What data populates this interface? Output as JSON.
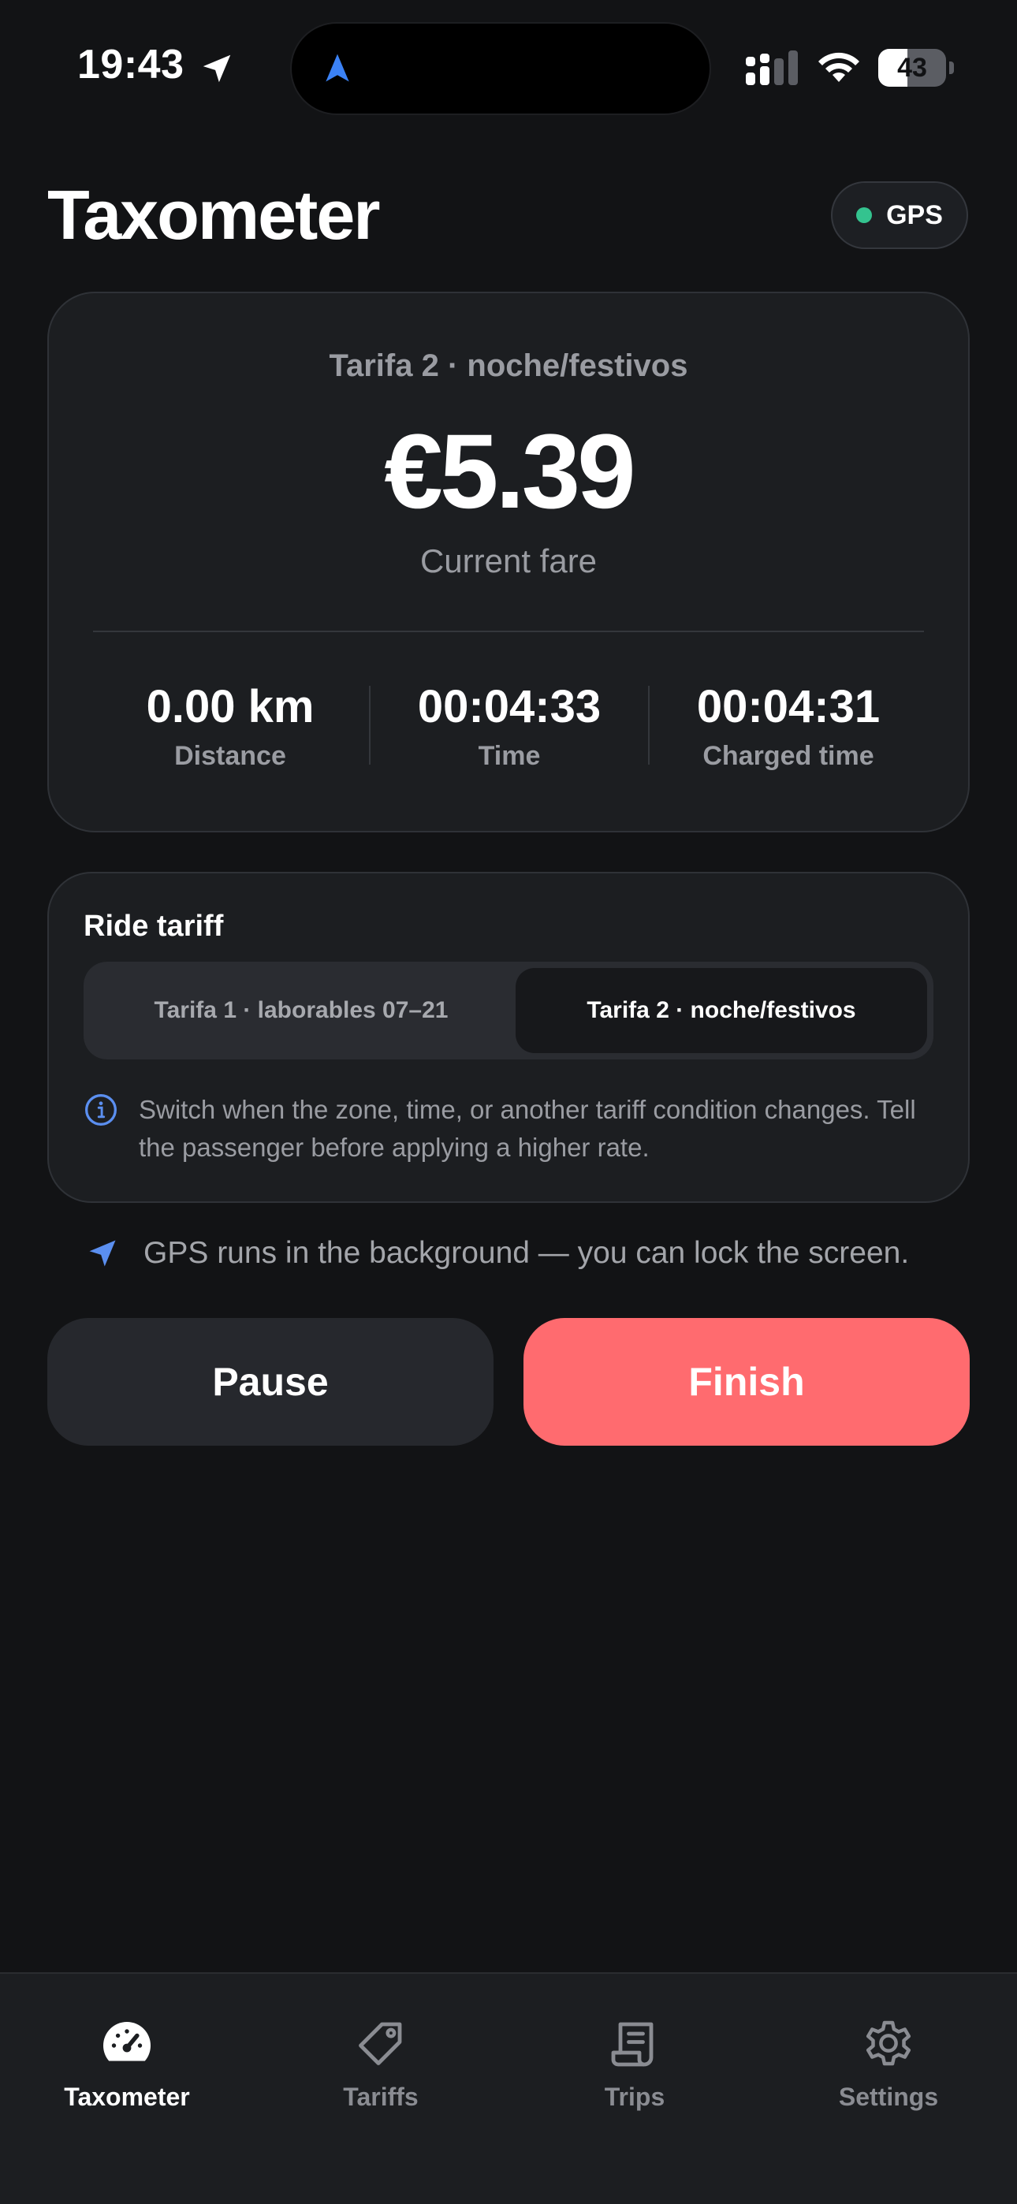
{
  "status_bar": {
    "time": "19:43",
    "battery": "43",
    "battery_level": 0.43
  },
  "header": {
    "title": "Taxometer",
    "gps_badge": "GPS"
  },
  "fare_card": {
    "tariff_label": "Tarifa 2 · noche/festivos",
    "amount": "€5.39",
    "caption": "Current fare",
    "stats": [
      {
        "value": "0.00 km",
        "label": "Distance"
      },
      {
        "value": "00:04:33",
        "label": "Time"
      },
      {
        "value": "00:04:31",
        "label": "Charged time"
      }
    ]
  },
  "tariff_card": {
    "heading": "Ride tariff",
    "options": [
      {
        "label": "Tarifa 1 · laborables 07–21",
        "selected": false
      },
      {
        "label": "Tarifa 2 · noche/festivos",
        "selected": true
      }
    ],
    "note": "Switch when the zone, time, or another tariff condition changes. Tell the passenger before applying a higher rate."
  },
  "gps_hint": "GPS runs in the background — you can lock the screen.",
  "actions": {
    "pause": "Pause",
    "finish": "Finish"
  },
  "tab_bar": {
    "items": [
      {
        "label": "Taxometer",
        "icon": "speedometer-icon",
        "active": true
      },
      {
        "label": "Tariffs",
        "icon": "tag-icon",
        "active": false
      },
      {
        "label": "Trips",
        "icon": "receipt-icon",
        "active": false
      },
      {
        "label": "Settings",
        "icon": "gear-icon",
        "active": false
      }
    ]
  },
  "colors": {
    "background": "#121315",
    "card": "#1c1e21",
    "accent_finish": "#ff6b6f",
    "gps_ok": "#34c38f",
    "nav_blue": "#3b82f6"
  }
}
